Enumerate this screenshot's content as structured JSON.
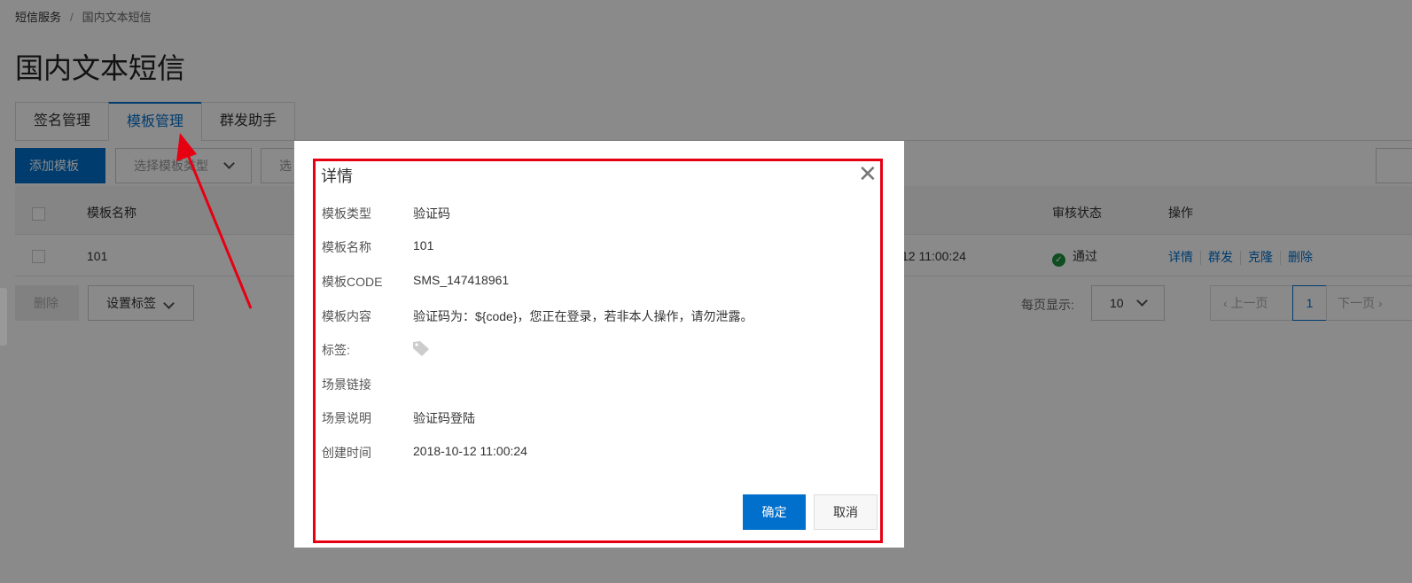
{
  "breadcrumb": [
    "短信服务",
    "国内文本短信"
  ],
  "page_title": "国内文本短信",
  "tabs": [
    {
      "label": "签名管理"
    },
    {
      "label": "模板管理",
      "active": true
    },
    {
      "label": "群发助手"
    }
  ],
  "toolbar": {
    "add": "添加模板",
    "type_select": "选择模板类型",
    "second_select": "选"
  },
  "table": {
    "headers": {
      "name": "模板名称",
      "status": "审核状态",
      "actions": "操作"
    },
    "rows": [
      {
        "name": "101",
        "created": "12 11:00:24",
        "status": "通过",
        "actions": [
          "详情",
          "群发",
          "克隆",
          "删除"
        ]
      }
    ]
  },
  "footer": {
    "delete": "删除",
    "set_tag": "设置标签",
    "page_size_label": "每页显示:",
    "page_size": "10",
    "prev": "上一页",
    "page": "1",
    "next": "下一页"
  },
  "dialog": {
    "title": "详情",
    "fields": [
      {
        "label": "模板类型",
        "value": "验证码"
      },
      {
        "label": "模板名称",
        "value": "101"
      },
      {
        "label": "模板CODE",
        "value": "SMS_147418961"
      },
      {
        "label": "模板内容",
        "value": "验证码为：${code}，您正在登录，若非本人操作，请勿泄露。"
      },
      {
        "label": "标签:",
        "value": ""
      },
      {
        "label": "场景链接",
        "value": ""
      },
      {
        "label": "场景说明",
        "value": "验证码登陆"
      },
      {
        "label": "创建时间",
        "value": "2018-10-12 11:00:24"
      }
    ],
    "ok": "确定",
    "cancel": "取消"
  },
  "colors": {
    "primary": "#0070cc",
    "annotation": "#e60012",
    "success": "#1e8e3e"
  }
}
